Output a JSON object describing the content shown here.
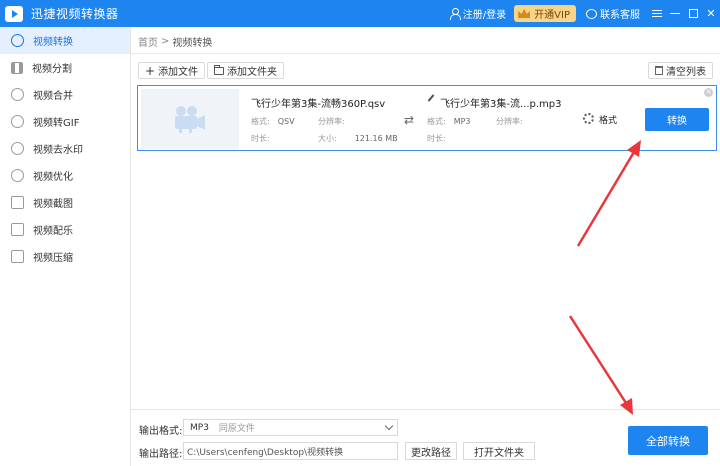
{
  "window": {
    "title": "迅捷视频转换器",
    "login_label": "注册/登录",
    "vip_label": "开通VIP",
    "support_label": "联系客服"
  },
  "sidebar": {
    "items": [
      {
        "label": "视频转换",
        "icon": "video-convert-icon",
        "active": true
      },
      {
        "label": "视频分割",
        "icon": "video-split-icon"
      },
      {
        "label": "视频合并",
        "icon": "video-merge-icon"
      },
      {
        "label": "视频转GIF",
        "icon": "gif-icon"
      },
      {
        "label": "视频去水印",
        "icon": "watermark-icon"
      },
      {
        "label": "视频优化",
        "icon": "optimize-icon"
      },
      {
        "label": "视频截图",
        "icon": "screenshot-icon"
      },
      {
        "label": "视频配乐",
        "icon": "music-icon"
      },
      {
        "label": "视频压缩",
        "icon": "compress-icon"
      }
    ]
  },
  "breadcrumb": {
    "home": "首页",
    "separator": ">",
    "current": "视频转换"
  },
  "toolbar": {
    "add_file": "添加文件",
    "add_folder": "添加文件夹",
    "clear_list": "清空列表"
  },
  "file": {
    "source_name": "飞行少年第3集-流畅360P.qsv",
    "source_format_label": "格式:",
    "source_format": "QSV",
    "source_resolution_label": "分辨率:",
    "source_resolution": "",
    "source_duration_label": "时长:",
    "source_size_label": "大小:",
    "source_size": "121.16 MB",
    "target_name": "飞行少年第3集-流...p.mp3",
    "target_format_label": "格式:",
    "target_format": "MP3",
    "target_resolution_label": "分辨率:",
    "target_duration_label": "时长:",
    "settings_label": "格式",
    "convert_label": "转换"
  },
  "output": {
    "format_label": "输出格式:",
    "format_value": "MP3",
    "format_sub": "同原文件",
    "path_label": "输出路径:",
    "path_value": "C:\\Users\\cenfeng\\Desktop\\视频转换",
    "change_path": "更改路径",
    "open_folder": "打开文件夹",
    "convert_all": "全部转换"
  },
  "colors": {
    "accent": "#1e85f0",
    "active_nav_bg": "#e4efff",
    "vip": "#f8d38a",
    "annotation": "#e8383d"
  }
}
